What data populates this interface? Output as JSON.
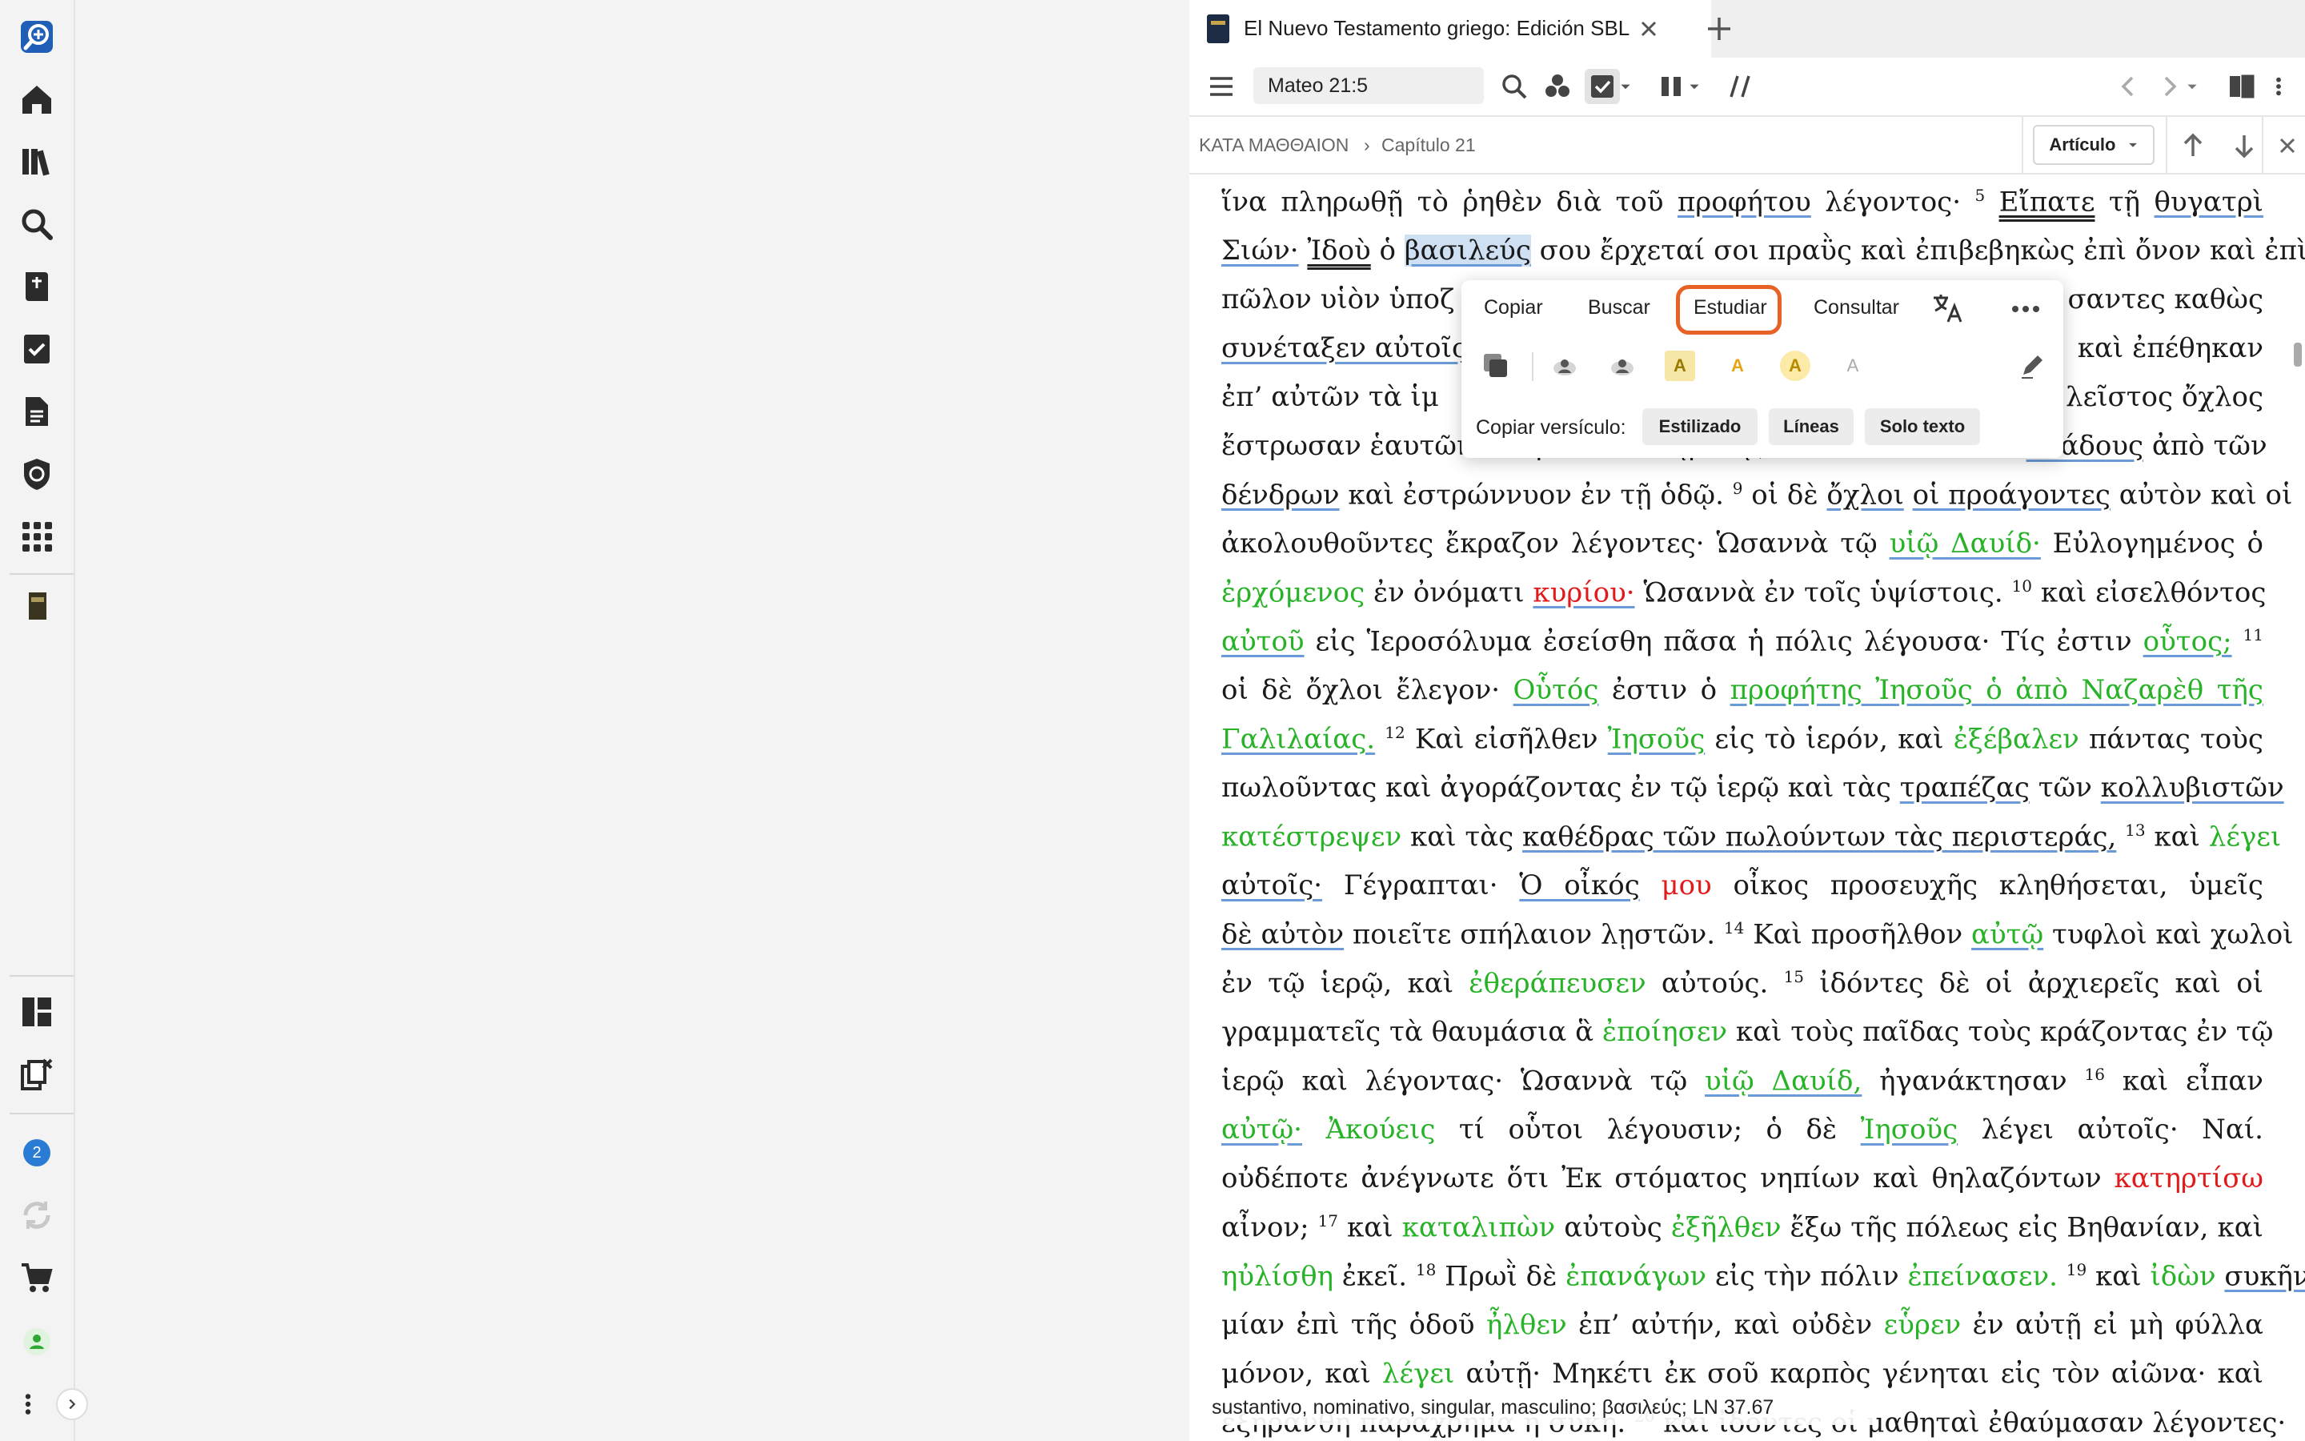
{
  "tab": {
    "title": "El Nuevo Testamento griego: Edición SBL"
  },
  "toolbar": {
    "reference": "Mateo 21:5"
  },
  "breadcrumb": {
    "book": "ΚΑΤΑ ΜΑΘΘΑΙΟΝ",
    "separator": "›",
    "chapter": "Capítulo 21",
    "view": "Artículo"
  },
  "sidebar": {
    "notification_count": "2"
  },
  "context_menu": {
    "items": [
      "Copiar",
      "Buscar",
      "Estudiar",
      "Consultar"
    ],
    "copy_verse_label": "Copiar versículo:",
    "copy_options": [
      "Estilizado",
      "Líneas",
      "Solo texto"
    ],
    "highlight_letter": "A"
  },
  "text": {
    "l1a": "ἵνα πληρωθῇ τὸ ῥηθὲν διὰ τοῦ",
    "l1b": "προφήτου",
    "l1c": "λέγοντος·",
    "v5": "5",
    "l1d": "Εἴπατε",
    "l1e": "τῇ",
    "l1f": "θυγατρὶ",
    "l2a": "Σιών·",
    "l2b": "Ἰδοὺ",
    "l2c": "ὁ",
    "l2d": "βασιλεύς",
    "l2e": "σου ἔρχεταί σοι πραῢς καὶ ἐπιβεβηκὼς ἐπὶ ὄνον καὶ",
    "l2f": "ἐπὶ",
    "l3a": "πῶλον υἱὸν ὑποζ",
    "l3b": "σαντες καθὼς",
    "l4a": "συνέταξεν αὐτοῖς",
    "l4b": "καὶ ἐπέθηκαν",
    "l5a": "ἐπ’ αὐτῶν τὰ ἱμ",
    "l5b": "λεῖστος ὄχλος",
    "l6a": "ἔστρωσαν ἑαυτῶν τὰ ἱμάτια ἐν τῇ ὁδῷ, ἄλλοι δὲ ἔκοπτον",
    "l6b": "κλάδους",
    "l6c": "ἀπὸ τῶν",
    "l7a": "δένδρων",
    "l7b": "καὶ ἐστρώννυον ἐν τῇ ὁδῷ.",
    "v9": "9",
    "l7c": "οἱ δὲ",
    "l7d": "ὄχλοι",
    "l7e": "οἱ προάγοντες",
    "l7f": "αὐτὸν καὶ οἱ",
    "l8a": "ἀκολουθοῦντες ἔκραζον λέγοντες·",
    "l8b": "Ὡσαννὰ τῷ",
    "l8c": "υἱῷ Δαυίδ·",
    "l8d": "Εὐλογημένος ὁ",
    "l9a": "ἐρχόμενος",
    "l9b": "ἐν ὀνόματι",
    "l9c": "κυρίου·",
    "l9d": "Ὡσαννὰ ἐν τοῖς ὑψίστοις.",
    "v10": "10",
    "l9e": "καὶ εἰσελθόντος",
    "l10a": "αὐτοῦ",
    "l10b": "εἰς Ἱεροσόλυμα ἐσείσθη πᾶσα ἡ πόλις λέγουσα·",
    "l10c": "Τίς ἐστιν",
    "l10d": "οὗτος;",
    "v11": "11",
    "l11a": "οἱ δὲ ὄχλοι ἔλεγον·",
    "l11b": "Οὗτός",
    "l11c": "ἐστιν ὁ",
    "l11d": "προφήτης Ἰησοῦς ὁ ἀπὸ Ναζαρὲθ τῆς",
    "l12a": "Γαλιλαίας.",
    "v12": "12",
    "l12b": "Καὶ εἰσῆλθεν",
    "l12c": "Ἰησοῦς",
    "l12d": "εἰς τὸ ἱερόν, καὶ",
    "l12e": "ἐξέβαλεν",
    "l12f": "πάντας τοὺς",
    "l13a": "πωλοῦντας καὶ ἀγοράζοντας ἐν τῷ ἱερῷ καὶ τὰς",
    "l13b": "τραπέζας",
    "l13c": "τῶν",
    "l13d": "κολλυβιστῶν",
    "l14a": "κατέστρεψεν",
    "l14b": "καὶ τὰς",
    "l14c": "καθέδρας τῶν πωλούντων τὰς περιστεράς,",
    "v13": "13",
    "l14d": "καὶ",
    "l14e": "λέγει",
    "l15a": "αὐτοῖς·",
    "l15b": "Γέγραπται·",
    "l15c": "Ὁ οἶκός",
    "l15d": "μου",
    "l15e": "οἶκος προσευχῆς κληθήσεται, ὑμεῖς",
    "l16a": "δὲ αὐτὸν",
    "l16b": "ποιεῖτε σπήλαιον λῃστῶν.",
    "v14": "14",
    "l16c": "Καὶ προσῆλθον",
    "l16d": "αὐτῷ",
    "l16e": "τυφλοὶ καὶ χωλοὶ",
    "l17a": "ἐν τῷ ἱερῷ, καὶ",
    "l17b": "ἐθεράπευσεν",
    "l17c": "αὐτούς.",
    "v15": "15",
    "l17d": "ἰδόντες δὲ οἱ ἀρχιερεῖς καὶ οἱ",
    "l18a": "γραμματεῖς τὰ θαυμάσια ἃ",
    "l18b": "ἐποίησεν",
    "l18c": "καὶ τοὺς παῖδας",
    "l18d": "τοὺς κράζοντας ἐν τῷ",
    "l19a": "ἱερῷ καὶ λέγοντας·",
    "l19b": "Ὡσαννὰ τῷ",
    "l19c": "υἱῷ Δαυίδ,",
    "l19d": "ἠγανάκτησαν",
    "v16": "16",
    "l19e": "καὶ εἶπαν",
    "l20a": "αὐτῷ·",
    "l20b": "Ἀκούεις",
    "l20c": "τί οὗτοι λέγουσιν; ὁ δὲ",
    "l20d": "Ἰησοῦς",
    "l20e": "λέγει αὐτοῖς·",
    "l20f": "Ναί.",
    "l21a": "οὐδέποτε ἀνέγνωτε ὅτι",
    "l21b": "Ἐκ στόματος νηπίων καὶ θηλαζόντων",
    "l21c": "κατηρτίσω",
    "l22a": "αἶνον;",
    "v17": "17",
    "l22b": "καὶ",
    "l22c": "καταλιπὼν",
    "l22d": "αὐτοὺς",
    "l22e": "ἐξῆλθεν",
    "l22f": "ἔξω τῆς πόλεως εἰς Βηθανίαν, καὶ",
    "l23a": "ηὐλίσθη",
    "l23b": "ἐκεῖ.",
    "v18": "18",
    "l23c": "Πρωῒ δὲ",
    "l23d": "ἐπανάγων",
    "l23e": "εἰς τὴν πόλιν",
    "l23f": "ἐπείνασεν.",
    "v19": "19",
    "l23g": "καὶ",
    "l23h": "ἰδὼν",
    "l23i": "συκῆν",
    "l24a": "μίαν ἐπὶ τῆς ὁδοῦ",
    "l24b": "ἦλθεν",
    "l24c": "ἐπ’ αὐτήν, καὶ οὐδὲν",
    "l24d": "εὗρεν",
    "l24e": "ἐν αὐτῇ εἰ μὴ φύλλα",
    "l25a": "μόνον, καὶ",
    "l25b": "λέγει",
    "l25c": "αὐτῇ·",
    "l25d": "Μηκέτι ἐκ σοῦ καρπὸς γένηται εἰς τὸν αἰῶνα· καὶ",
    "l26a": "ἐξηράνθη παραχρῆμα ἡ συκῆ.",
    "v20": "20",
    "l26b": "καὶ ἰδόντες οἱ μαθηταὶ ἐθαύμασαν λέγοντες·"
  },
  "status": {
    "text": "sustantivo, nominativo, singular, masculino; βασιλεύς; LN 37.67"
  },
  "colors": {
    "jesus_words": "#27b227",
    "divine_words": "#e11b1b",
    "highlight": "#cfe0f3",
    "focus_ring": "#e76224",
    "accent": "#2a7bd4"
  }
}
